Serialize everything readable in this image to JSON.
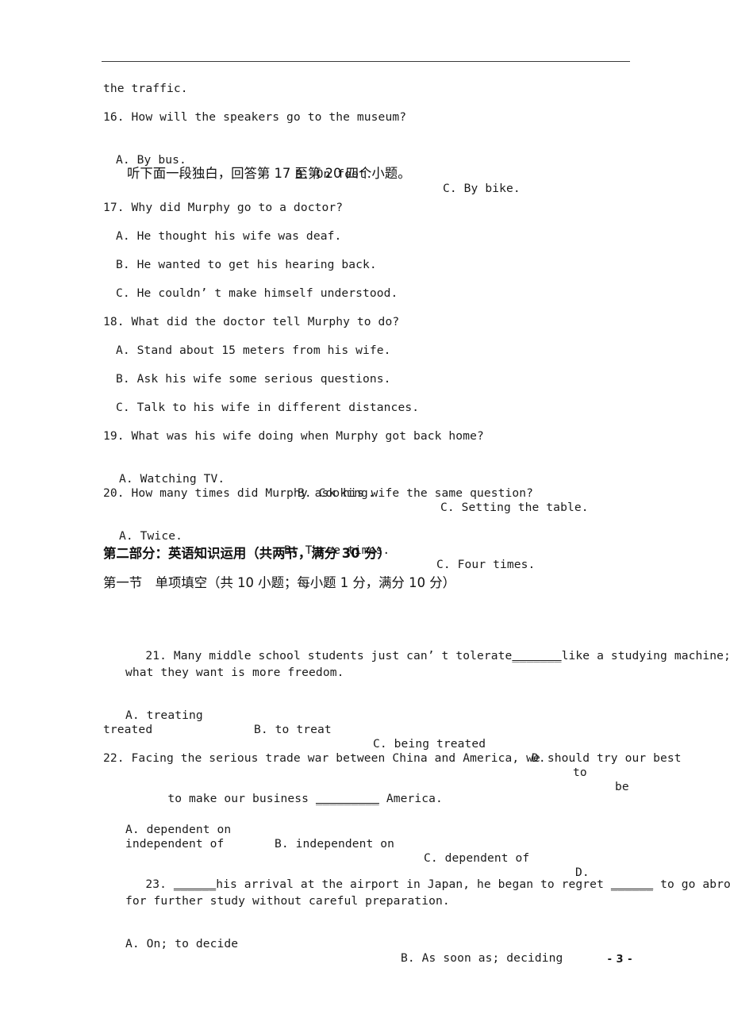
{
  "document": {
    "page_number_label": "- 3 -",
    "header_rule": true
  },
  "body": {
    "continued_line": "the traffic.",
    "q16": {
      "stem": "16. How will the speakers go to the museum?",
      "options": [
        "A. By bus.",
        "B. On foot.",
        "C. By bike."
      ]
    },
    "monologue_instruction": "听下面一段独白，回答第 17 至第 20 四个小题。",
    "q17": {
      "stem": "17. Why did Murphy go to a doctor?",
      "options": [
        "A. He thought his wife was deaf.",
        "B. He wanted to get his hearing back.",
        "C. He couldn’ t make himself understood."
      ]
    },
    "q18": {
      "stem": "18. What did the doctor tell Murphy to do?",
      "options": [
        "A. Stand about 15 meters from his wife.",
        "B. Ask his wife some serious questions.",
        "C. Talk to his wife in different distances."
      ]
    },
    "q19": {
      "stem": "19. What was his wife doing when Murphy got back home?",
      "options": [
        "A. Watching TV.",
        "B. Cooking.",
        "C. Setting the table."
      ]
    },
    "q20": {
      "stem": "20. How many times did Murphy ask his wife the same question?",
      "options": [
        "A. Twice.",
        "B. Three times.",
        "C. Four times."
      ]
    },
    "part_two_heading": "第二部分：英语知识运用（共两节，满分 30 分）",
    "section_one_heading": "第一节　单项填空（共 10 小题；每小题 1 分，满分 10 分）",
    "q21": {
      "stem_line1_pre": "21. Many middle school students just can’ t tolerate",
      "stem_line1_blank": "_______",
      "stem_line1_post": "like a studying machine;",
      "stem_line2": "what they want is more freedom.",
      "options": [
        "A. treating",
        "B. to treat",
        "C. being treated",
        "D.",
        "to",
        "be"
      ],
      "option_wrap": "treated"
    },
    "q22": {
      "stem_line1": "22. Facing the serious trade war between China and America, we should try our best",
      "stem_line2_pre": "to make our business",
      "stem_line2_blank": "_________",
      "stem_line2_post": "America.",
      "options": [
        "A. dependent on",
        "B. independent on",
        "C. dependent of",
        "D."
      ],
      "option_wrap": "independent of"
    },
    "q23": {
      "stem_line1_pre": "23.",
      "stem_line1_blank1": "______",
      "stem_line1_mid": "his arrival at the airport in Japan, he began to regret",
      "stem_line1_blank2": "______",
      "stem_line1_post": "to go abroad",
      "stem_line2": "for further study without careful preparation.",
      "options": [
        "A. On; to decide",
        "B. As soon as; deciding"
      ]
    }
  }
}
